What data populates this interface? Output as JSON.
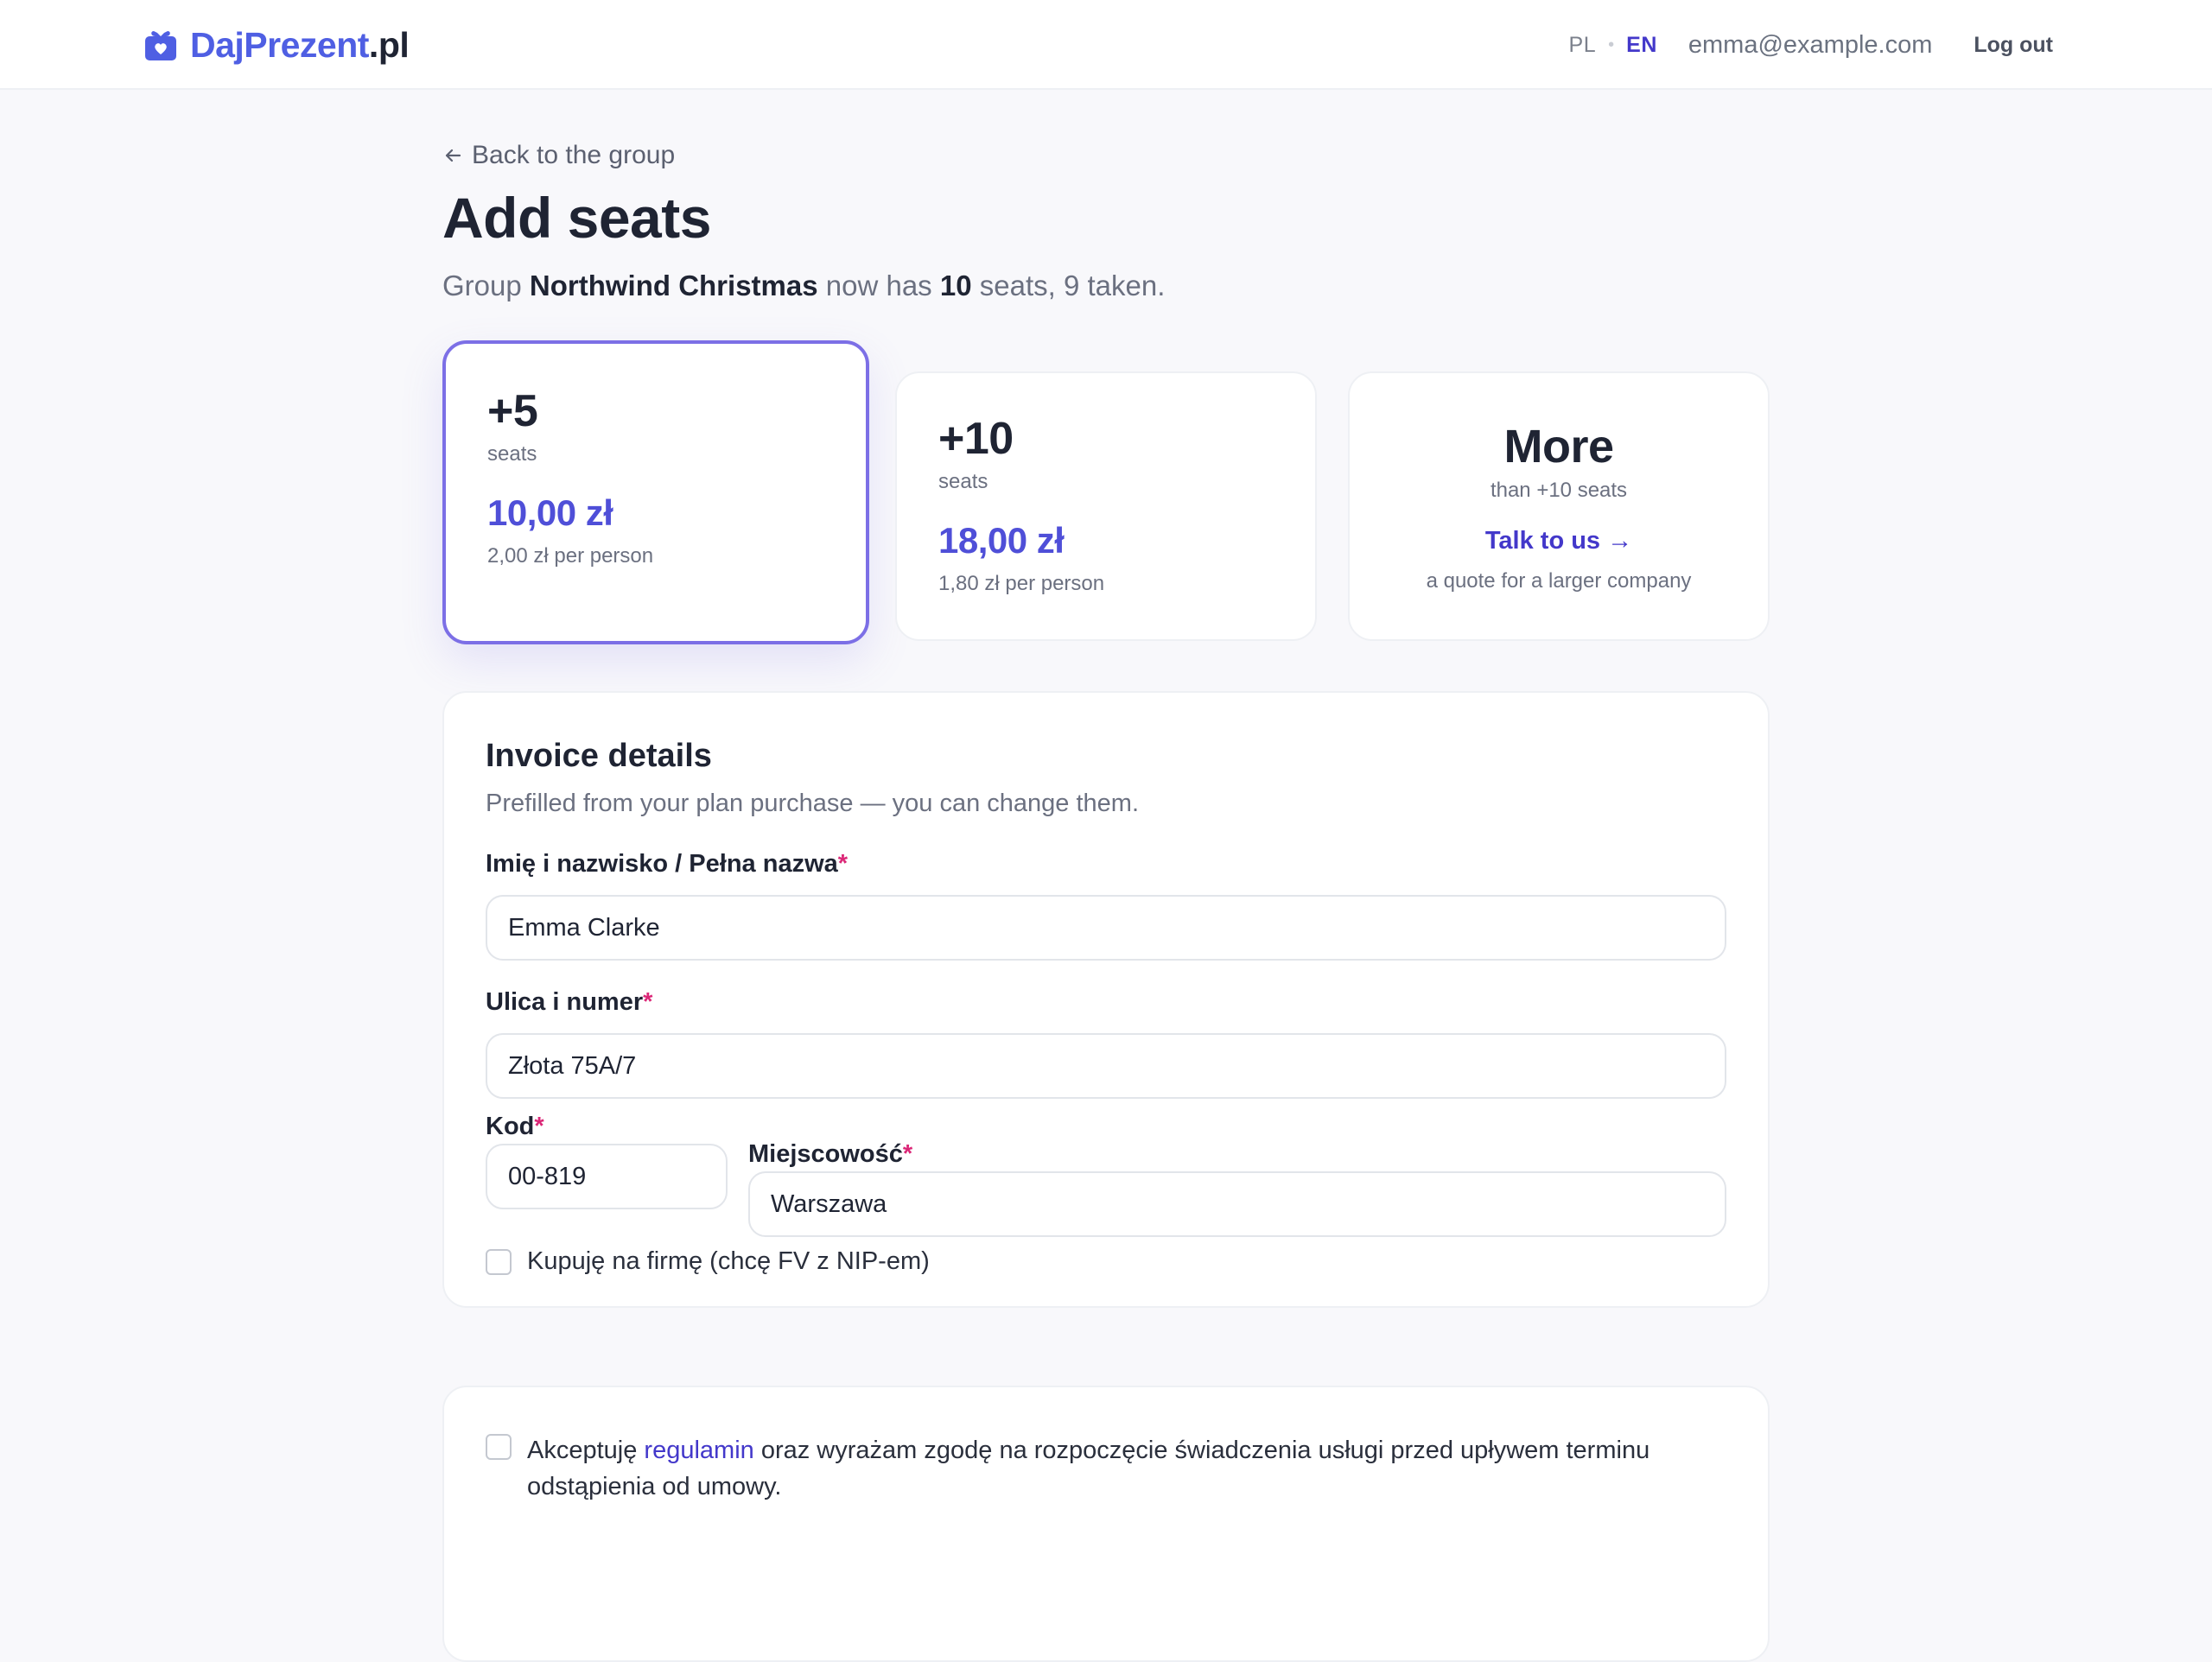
{
  "header": {
    "brand": "DajPrezent",
    "tld": ".pl",
    "lang_pl": "PL",
    "lang_en": "EN",
    "active_lang": "EN",
    "email": "emma@example.com",
    "logout": "Log out",
    "brand_color": "#4f5fe3",
    "accent_color": "#4338ca"
  },
  "page": {
    "back_link": "Back to the group",
    "title": "Add seats",
    "subtitle_prefix": "Group",
    "group_name": "Northwind Christmas",
    "subtitle_mid": "now has",
    "seat_count": "10",
    "subtitle_suffix": "seats, 9 taken."
  },
  "plans": [
    {
      "amount": "+5",
      "unit": "seats",
      "price": "10,00 zł",
      "per_person": "2,00 zł per person",
      "selected": true
    },
    {
      "amount": "+10",
      "unit": "seats",
      "price": "18,00 zł",
      "per_person": "1,80 zł per person",
      "selected": false
    },
    {
      "amount": "More",
      "unit": "than +10 seats",
      "cta": "Talk to us →",
      "note": "a quote for a larger company",
      "selected": false
    }
  ],
  "invoice": {
    "title": "Invoice details",
    "subtitle": "Prefilled from your plan purchase — you can change them.",
    "name_label": "Imię i nazwisko / Pełna nazwa",
    "name_value": "Emma Clarke",
    "street_label": "Ulica i numer",
    "street_value": "Złota 75A/7",
    "zip_label": "Kod",
    "zip_value": "00-819",
    "city_label": "Miejscowość",
    "city_value": "Warszawa",
    "required_mark": "*",
    "company_checkbox": "Kupuję na firmę (chcę FV z NIP-em)"
  },
  "terms": {
    "prefix": "Akceptuję",
    "link": "regulamin",
    "suffix": "oraz wyrażam zgodę na rozpoczęcie świadczenia usługi przed upływem terminu odstąpienia od umowy."
  }
}
